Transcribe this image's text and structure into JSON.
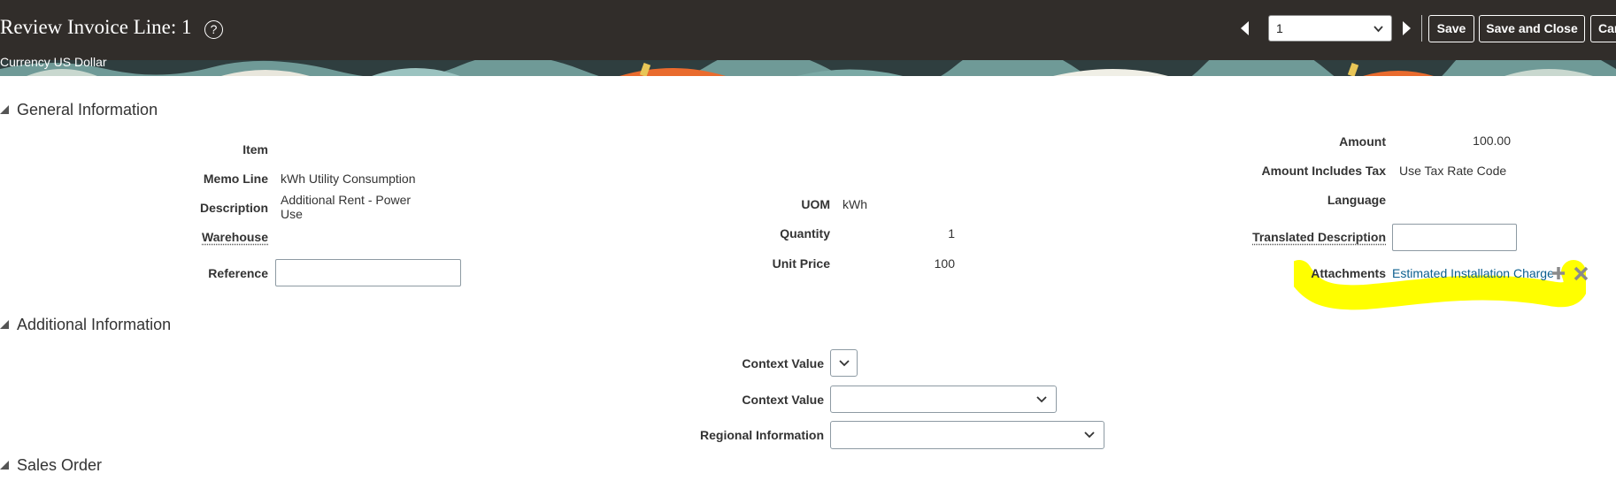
{
  "header": {
    "title": "Review Invoice Line: 1",
    "help_glyph": "?",
    "currency": "Currency US Dollar",
    "page_value": "1",
    "save_label": "Save",
    "save_close_label": "Save and Close",
    "cancel_label": "Cancel"
  },
  "general": {
    "heading": "General Information",
    "item_label": "Item",
    "memo_line_label": "Memo Line",
    "memo_line_value": "kWh Utility Consumption",
    "description_label": "Description",
    "description_line1": "Additional Rent - Power",
    "description_line2": "Use",
    "warehouse_label": "Warehouse",
    "reference_label": "Reference",
    "reference_value": "",
    "uom_label": "UOM",
    "uom_value": "kWh",
    "quantity_label": "Quantity",
    "quantity_value": "1",
    "unit_price_label": "Unit Price",
    "unit_price_value": "100",
    "amount_label": "Amount",
    "amount_value": "100.00",
    "amount_includes_tax_label": "Amount Includes Tax",
    "amount_includes_tax_value": "Use Tax Rate Code",
    "language_label": "Language",
    "translated_description_label": "Translated Description",
    "translated_description_value": "",
    "attachments_label": "Attachments",
    "attachment_link": "Estimated Installation Charge"
  },
  "additional": {
    "heading": "Additional Information",
    "context_value_label_1": "Context Value",
    "context_value_label_2": "Context Value",
    "context_value_2_value": "",
    "regional_information_label": "Regional Information",
    "regional_information_value": ""
  },
  "sales_order": {
    "heading": "Sales Order"
  },
  "colors": {
    "header_bg": "#312d2a",
    "link": "#0c5f8f",
    "highlight": "#ffff00"
  },
  "icons": [
    "help-icon",
    "previous-arrow-icon",
    "chevron-down-icon",
    "next-arrow-icon",
    "add-icon",
    "delete-icon",
    "collapse-triangle-icon"
  ]
}
